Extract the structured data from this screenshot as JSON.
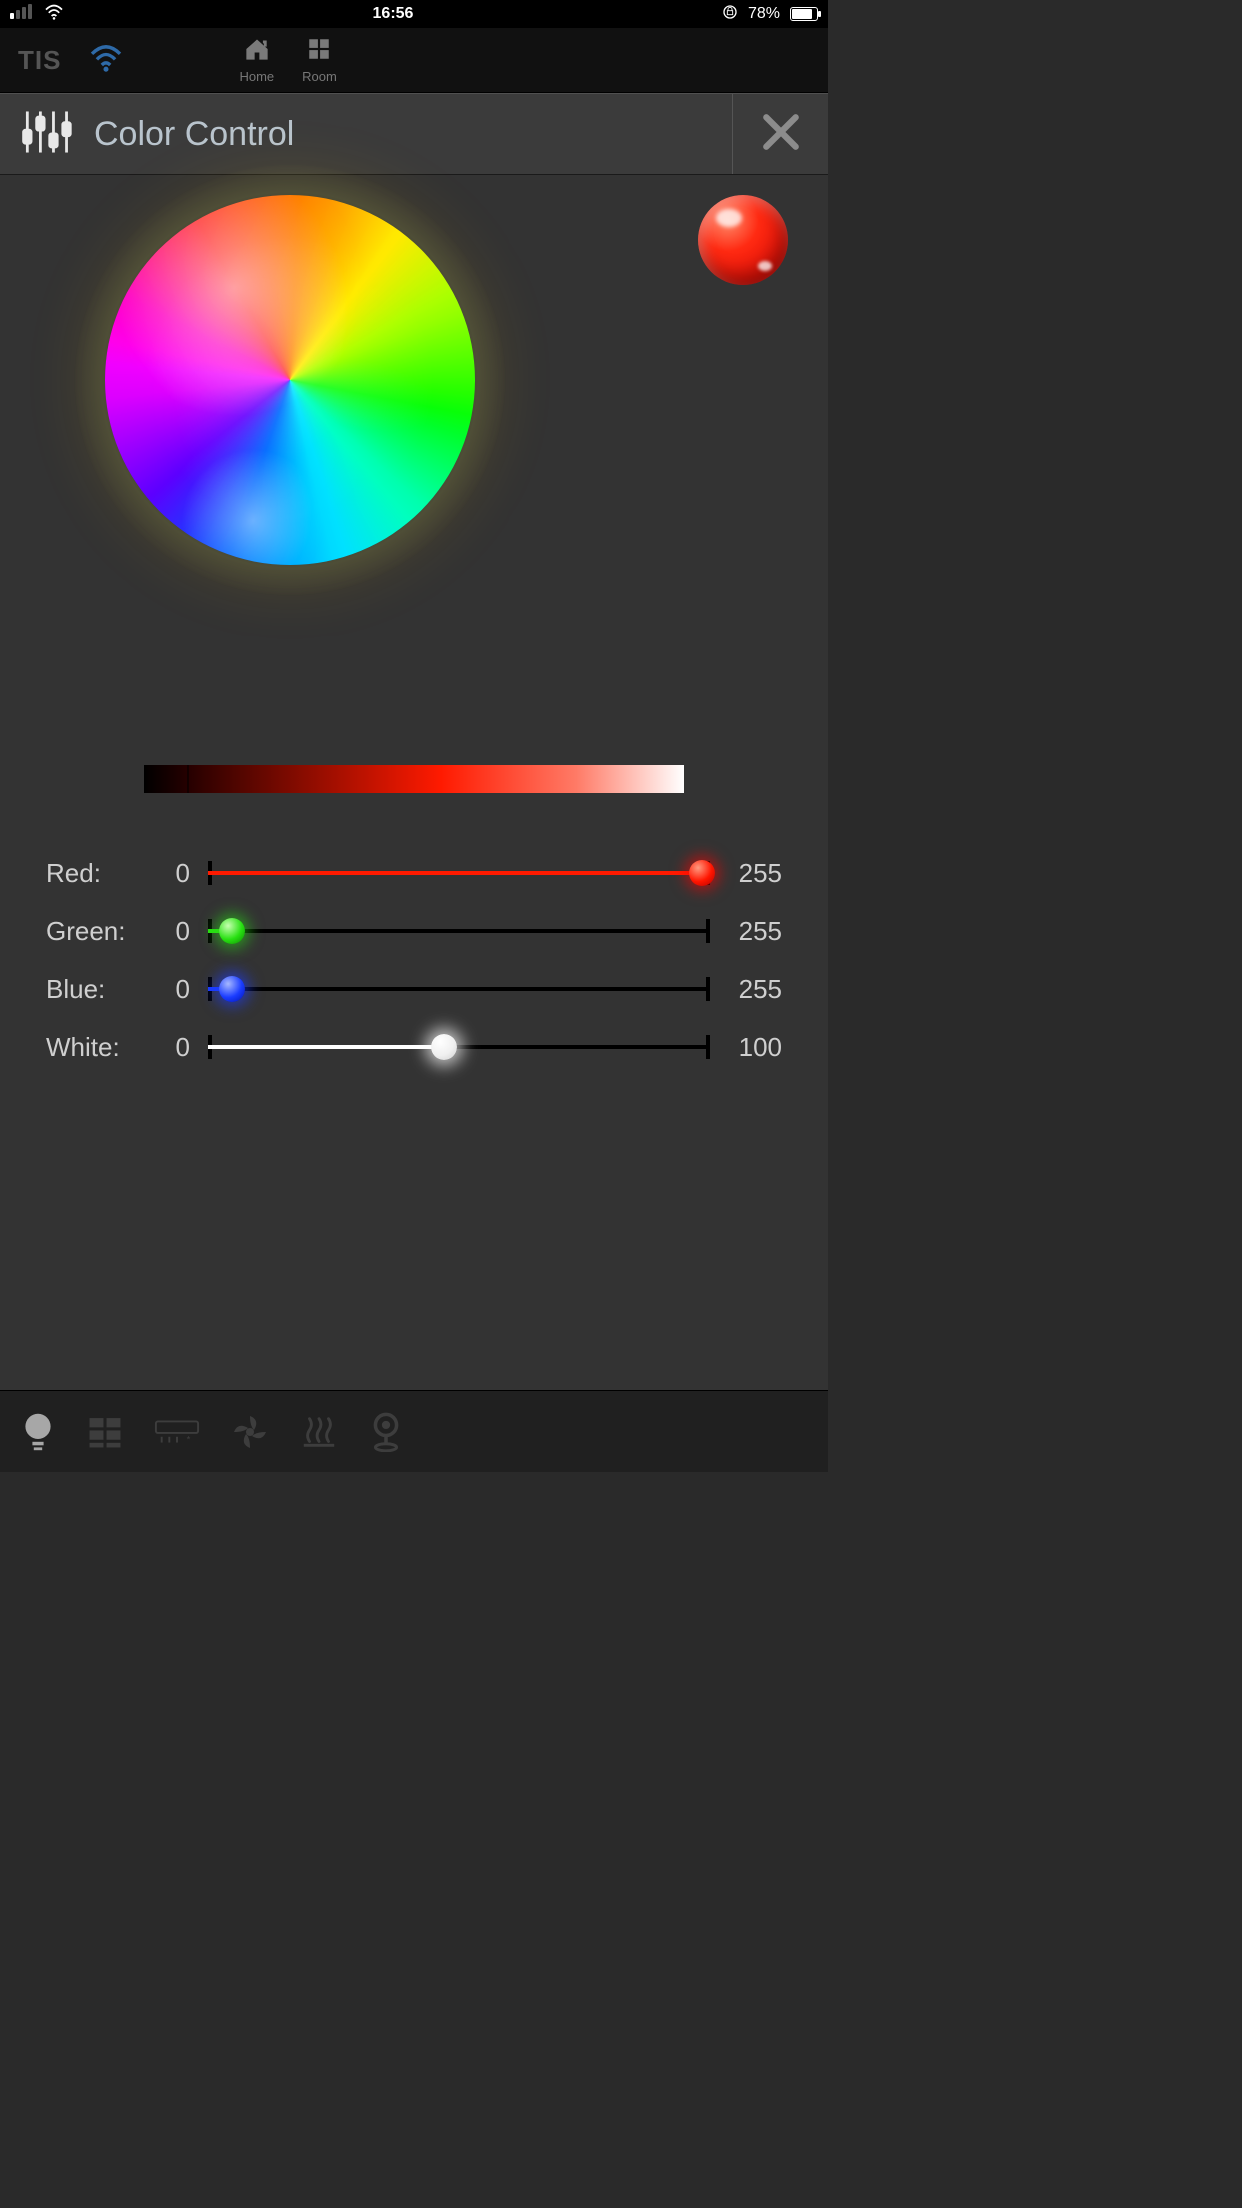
{
  "status": {
    "time": "16:56",
    "battery_text": "78%",
    "battery_pct": 78
  },
  "topnav": {
    "logo": "TIS",
    "home_label": "Home",
    "room_label": "Room"
  },
  "header": {
    "title": "Color Control"
  },
  "preview": {
    "color": "#ff1a00"
  },
  "sliders": {
    "red": {
      "label": "Red:",
      "min": "0",
      "max": "255",
      "value": 251,
      "range_max": 255,
      "color": "#ff1a00"
    },
    "green": {
      "label": "Green:",
      "min": "0",
      "max": "255",
      "value": 12,
      "range_max": 255,
      "color": "#28e012"
    },
    "blue": {
      "label": "Blue:",
      "min": "0",
      "max": "255",
      "value": 12,
      "range_max": 255,
      "color": "#1a3cff"
    },
    "white": {
      "label": "White:",
      "min": "0",
      "max": "100",
      "value": 47,
      "range_max": 100,
      "color": "#ffffff"
    }
  }
}
